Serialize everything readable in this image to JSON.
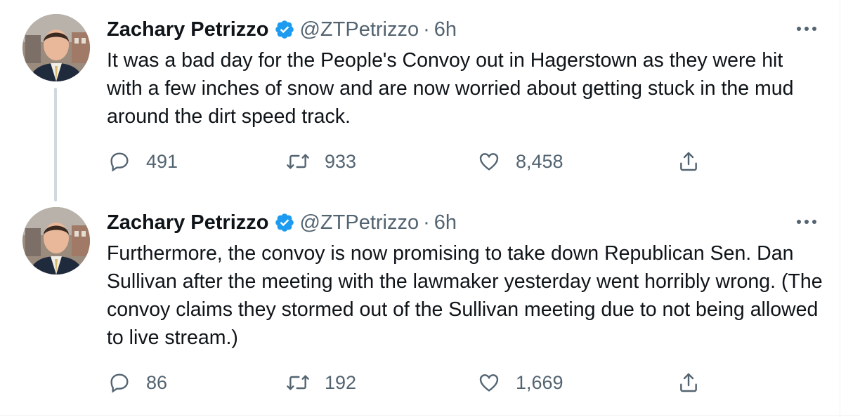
{
  "tweets": [
    {
      "author": {
        "display_name": "Zachary Petrizzo",
        "handle": "@ZTPetrizzo",
        "verified": true
      },
      "separator": "·",
      "time": "6h",
      "text": "It was a bad day for the People's Convoy out in Hagerstown as they were hit with a few inches of snow and are now worried about getting stuck in the mud around the dirt speed track.",
      "stats": {
        "replies": "491",
        "retweets": "933",
        "likes": "8,458"
      }
    },
    {
      "author": {
        "display_name": "Zachary Petrizzo",
        "handle": "@ZTPetrizzo",
        "verified": true
      },
      "separator": "·",
      "time": "6h",
      "text": "Furthermore, the convoy is now promising to take down Republican Sen. Dan Sullivan after the meeting with the lawmaker yesterday went horribly wrong. (The convoy claims they stormed out of the Sullivan meeting due to not being allowed to live stream.)",
      "stats": {
        "replies": "86",
        "retweets": "192",
        "likes": "1,669"
      }
    }
  ],
  "icons": {
    "verified": "verified-badge-icon",
    "more": "more-options-icon",
    "reply": "reply-icon",
    "retweet": "retweet-icon",
    "like": "heart-icon",
    "share": "share-icon"
  },
  "colors": {
    "text": "#0f1419",
    "secondary": "#536471",
    "verified": "#1d9bf0",
    "thread_line": "#cfd9de"
  }
}
